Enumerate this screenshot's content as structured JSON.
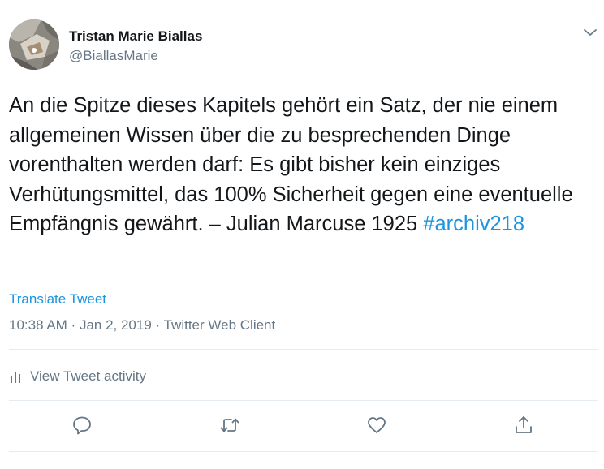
{
  "author": {
    "display_name": "Tristan Marie Biallas",
    "handle": "@BiallasMarie"
  },
  "tweet": {
    "text": "An die Spitze dieses Kapitels gehört ein Satz, der nie einem allgemeinen Wissen über die zu besprechenden Dinge vorenthalten werden darf: Es gibt bisher kein einziges Verhütungsmittel, das 100% Sicherheit gegen eine eventuelle Empfängnis gewährt. – Julian Marcuse 1925 ",
    "hashtag": "#archiv218",
    "translate_label": "Translate Tweet",
    "time": "10:38 AM",
    "date": "Jan 2, 2019",
    "client": "Twitter Web Client",
    "separator": " · "
  },
  "activity": {
    "label": "View Tweet activity",
    "icon": "bar-chart-icon"
  },
  "actions": {
    "reply_icon": "reply-icon",
    "retweet_icon": "retweet-icon",
    "like_icon": "heart-icon",
    "share_icon": "share-icon"
  },
  "colors": {
    "link": "#1b95e0",
    "secondary_text": "#657786",
    "primary_text": "#14171a",
    "divider": "#e6ecf0"
  }
}
